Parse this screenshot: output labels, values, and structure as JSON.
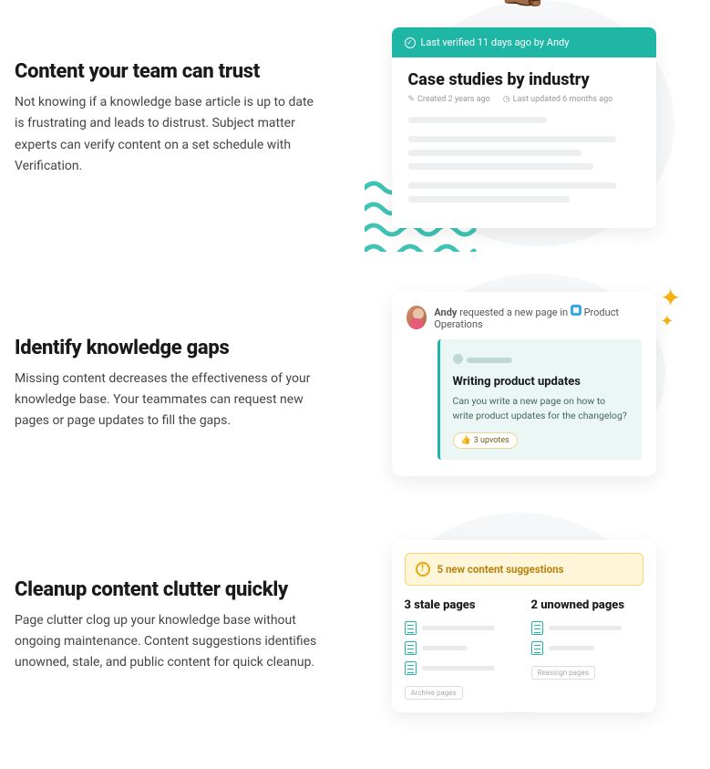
{
  "section1": {
    "heading": "Content your team can trust",
    "body": "Not knowing if a knowledge base article is up to date is frustrating and leads to distrust. Subject matter experts can verify content on a set schedule with Verification.",
    "card": {
      "verified_text": "Last verified 11 days ago by Andy",
      "title": "Case studies by industry",
      "created": "Created 2 years ago",
      "updated": "Last updated 6 months ago"
    }
  },
  "section2": {
    "heading": "Identify knowledge gaps",
    "body": "Missing content decreases the effectiveness of your knowledge base. Your teammates can request new pages or page updates to fill the gaps.",
    "card": {
      "requester": "Andy",
      "action_text": "requested a new page in",
      "space": "Product Operations",
      "req_title": "Writing product updates",
      "req_body": "Can you write a new page on how to write product updates for the changelog?",
      "upvotes": "3 upvotes"
    }
  },
  "section3": {
    "heading": "Cleanup content clutter quickly",
    "body": "Page clutter clog up your knowledge base without ongoing maintenance. Content suggestions identifies unowned, stale, and public content for quick cleanup.",
    "card": {
      "alert": "5 new content suggestions",
      "col1_title": "3 stale pages",
      "col2_title": "2 unowned pages",
      "btn1": "Archive pages",
      "btn2": "Reassign pages"
    }
  }
}
